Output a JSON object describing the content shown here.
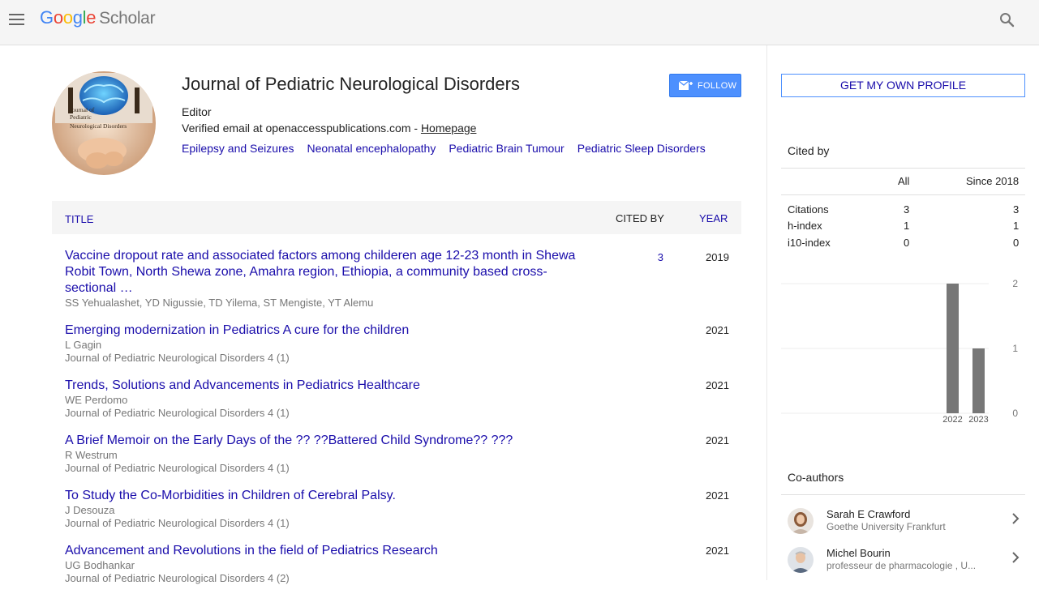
{
  "header": {
    "logo_google": "Google",
    "logo_scholar": "Scholar"
  },
  "profile": {
    "name": "Journal of Pediatric Neurological Disorders",
    "role": "Editor",
    "email_text": "Verified email at openaccesspublications.com - ",
    "homepage_label": "Homepage",
    "follow_label": "FOLLOW",
    "interests": [
      "Epilepsy and Seizures",
      "Neonatal encephalopathy",
      "Pediatric Brain Tumour",
      "Pediatric Sleep Disorders"
    ],
    "avatar_lines": [
      "Journal of",
      "Pediatric",
      "Neurological Disorders"
    ]
  },
  "table": {
    "col_title": "TITLE",
    "col_cited": "CITED BY",
    "col_year": "YEAR",
    "rows": [
      {
        "title": "Vaccine dropout rate and associated factors among childeren age 12-23 month in Shewa Robit Town, North Shewa zone, Amahra region, Ethiopia, a community based cross-sectional …",
        "authors": "SS Yehualashet, YD Nigussie, TD Yilema, ST Mengiste, YT Alemu",
        "source": "",
        "cited": "3",
        "year": "2019"
      },
      {
        "title": "Emerging modernization in Pediatrics A cure for the children",
        "authors": "L Gagin",
        "source": "Journal of Pediatric Neurological Disorders 4 (1)",
        "cited": "",
        "year": "2021"
      },
      {
        "title": "Trends, Solutions and Advancements in Pediatrics Healthcare",
        "authors": "WE Perdomo",
        "source": "Journal of Pediatric Neurological Disorders 4 (1)",
        "cited": "",
        "year": "2021"
      },
      {
        "title": "A Brief Memoir on the Early Days of the ?? ??Battered Child Syndrome?? ???",
        "authors": "R Westrum",
        "source": "Journal of Pediatric Neurological Disorders 4 (1)",
        "cited": "",
        "year": "2021"
      },
      {
        "title": "To Study the Co-Morbidities in Children of Cerebral Palsy.",
        "authors": "J Desouza",
        "source": "Journal of Pediatric Neurological Disorders 4 (1)",
        "cited": "",
        "year": "2021"
      },
      {
        "title": "Advancement and Revolutions in the field of Pediatrics Research",
        "authors": "UG Bodhankar",
        "source": "Journal of Pediatric Neurological Disorders 4 (2)",
        "cited": "",
        "year": "2021"
      }
    ]
  },
  "sidebar": {
    "own_profile_label": "GET MY OWN PROFILE",
    "cited_by_title": "Cited by",
    "col_all": "All",
    "col_since": "Since 2018",
    "stats": [
      {
        "label": "Citations",
        "all": "3",
        "since": "3"
      },
      {
        "label": "h-index",
        "all": "1",
        "since": "1"
      },
      {
        "label": "i10-index",
        "all": "0",
        "since": "0"
      }
    ],
    "coauthors_title": "Co-authors",
    "coauthors": [
      {
        "name": "Sarah E Crawford",
        "affiliation": "Goethe University Frankfurt"
      },
      {
        "name": "Michel Bourin",
        "affiliation": "professeur de pharmacologie , U..."
      }
    ]
  },
  "chart_data": {
    "type": "bar",
    "categories": [
      "2022",
      "2023"
    ],
    "values": [
      2,
      1
    ],
    "ylim": [
      0,
      2
    ],
    "yticks": [
      "0",
      "1",
      "2"
    ],
    "grid": true,
    "bar_color": "#777777"
  }
}
